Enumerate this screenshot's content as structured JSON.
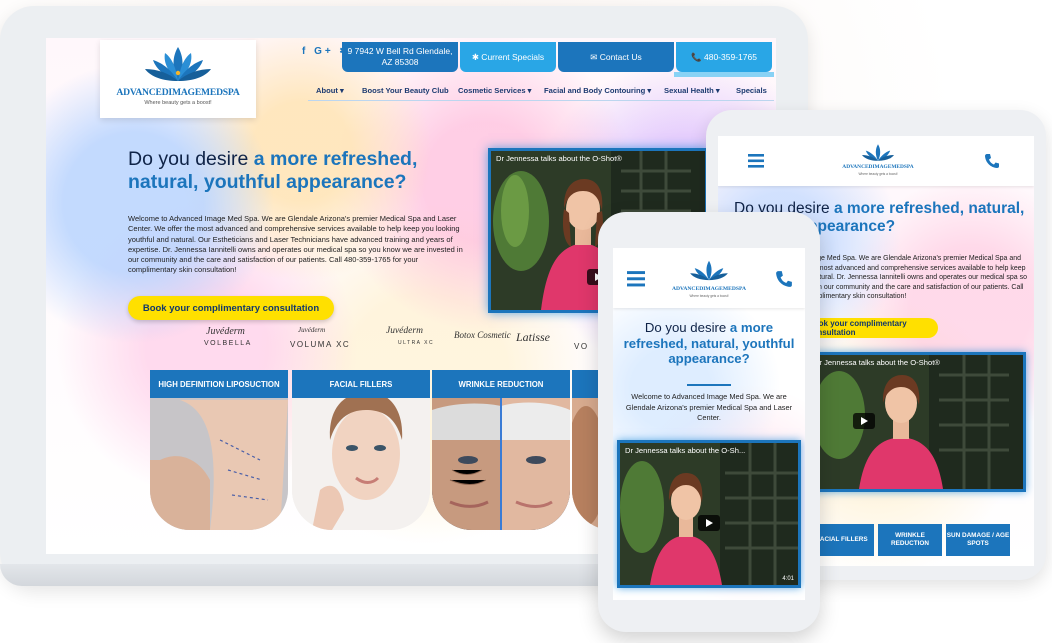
{
  "brand": {
    "name": "ADVANCEDIMAGEMEDSPA",
    "tagline": "Where beauty gets a boost!",
    "primary_color": "#1c75bc",
    "accent_color": "#29a6e6",
    "cta_color": "#ffe000"
  },
  "desktop": {
    "social_icons": [
      "facebook-icon",
      "google-plus-icon",
      "yelp-icon"
    ],
    "social_text": "f G+ ✱",
    "address": "9 7942 W Bell Rd Glendale, AZ 85308",
    "current_specials": "✱ Current Specials",
    "contact_us": "✉ Contact Us",
    "phone": "📞 480-359-1765",
    "nav": [
      "About ▾",
      "Boost Your Beauty Club",
      "Cosmetic Services ▾",
      "Facial and Body Contouring ▾",
      "Sexual Health ▾",
      "Specials"
    ],
    "headline_plain": "Do you desire ",
    "headline_bold": "a more refreshed, natural, youthful appearance?",
    "intro_text": "Welcome to Advanced Image Med Spa. We are Glendale Arizona's premier Medical Spa and Laser Center. We offer the most advanced and comprehensive services available to help keep you looking youthful and natural. Our Estheticians and Laser Technicians have advanced training and years of expertise. Dr. Jennessa Iannitelli owns and operates our medical spa so you know we are invested in our community and the care and satisfaction of our patients. Call 480-359-1765 for your complimentary skin consultation!",
    "cta_label": "Book your complimentary consultation",
    "video_title": "Dr Jennessa talks about the O-Shot®",
    "brands": [
      "Juvéderm",
      "VOLBELLA",
      "Juvéderm",
      "VOLUMA XC",
      "Juvéderm",
      "ULTRA XC",
      "Botox Cosmetic",
      "Latisse",
      "VO"
    ],
    "tiles": [
      "HIGH DEFINITION LIPOSUCTION",
      "FACIAL FILLERS",
      "WRINKLE REDUCTION",
      "SUN"
    ]
  },
  "tablet": {
    "headline_plain": "Do you desire ",
    "headline_bold": "a more refreshed, natural, youthful appearance?",
    "intro_text": "Welcome to Advanced Image Med Spa. We are Glendale Arizona's premier Medical Spa and Laser Center. We offer the most advanced and comprehensive services available to help keep you looking youthful and natural. Dr. Jennessa Iannitelli owns and operates our medical spa so you know we are invested in our community and the care and satisfaction of our patients. Call 480-359-1765 for your complimentary skin consultation!",
    "cta_label": "Book your complimentary consultation",
    "video_title": "Dr Jennessa talks about the O-Shot®",
    "buttons": [
      "FACIAL FILLERS",
      "WRINKLE REDUCTION",
      "SUN DAMAGE / AGE SPOTS"
    ]
  },
  "phone": {
    "headline_plain": "Do you desire ",
    "headline_bold": "a more refreshed, natural, youthful appearance?",
    "intro_text": "Welcome to Advanced Image Med Spa. We are Glendale Arizona's premier Medical Spa and Laser Center.",
    "video_title": "Dr Jennessa talks about the O-Sh...",
    "video_time": "4:01"
  }
}
